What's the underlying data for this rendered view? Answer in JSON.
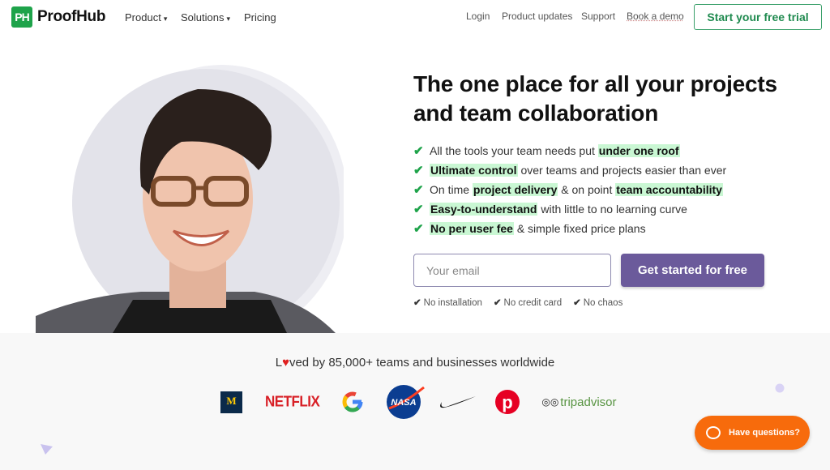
{
  "header": {
    "logo_mark": "PH",
    "logo_name": "ProofHub",
    "nav": [
      {
        "label": "Product",
        "caret": "▾"
      },
      {
        "label": "Solutions",
        "caret": "▾"
      },
      {
        "label": "Pricing"
      }
    ],
    "links": [
      "Login",
      "Product updates",
      "Support",
      "Book a demo"
    ],
    "cta": "Start your free trial"
  },
  "hero": {
    "title": "The one place for all your projects and team collaboration",
    "bullets": [
      {
        "parts": [
          {
            "t": "All the tools your team needs put "
          },
          {
            "t": "under one roof",
            "hl": true
          }
        ]
      },
      {
        "parts": [
          {
            "t": "Ultimate control",
            "hl": true
          },
          {
            "t": " over teams and projects easier than ever"
          }
        ]
      },
      {
        "parts": [
          {
            "t": "On time "
          },
          {
            "t": "project delivery",
            "hl": true
          },
          {
            "t": " & on point "
          },
          {
            "t": "team accountability",
            "hl": true
          }
        ]
      },
      {
        "parts": [
          {
            "t": "Easy-to-understand",
            "hl": true
          },
          {
            "t": " with little to no learning curve"
          }
        ]
      },
      {
        "parts": [
          {
            "t": "No per user fee",
            "hl": true
          },
          {
            "t": " & simple fixed price plans"
          }
        ]
      }
    ],
    "email_placeholder": "Your email",
    "submit": "Get started for free",
    "notes": [
      "No installation",
      "No credit card",
      "No chaos"
    ]
  },
  "social": {
    "loved_prefix": "L",
    "loved_suffix": "ved by 85,000+ teams and businesses worldwide",
    "logos": [
      "Michigan",
      "NETFLIX",
      "Google",
      "NASA",
      "Nike",
      "Pinterest",
      "tripadvisor"
    ]
  },
  "chat": {
    "label": "Have questions?"
  },
  "colors": {
    "brand": "#1ea34a",
    "highlight": "#c9f7d3",
    "button": "#6b5a9b",
    "chat": "#f76b0c"
  }
}
